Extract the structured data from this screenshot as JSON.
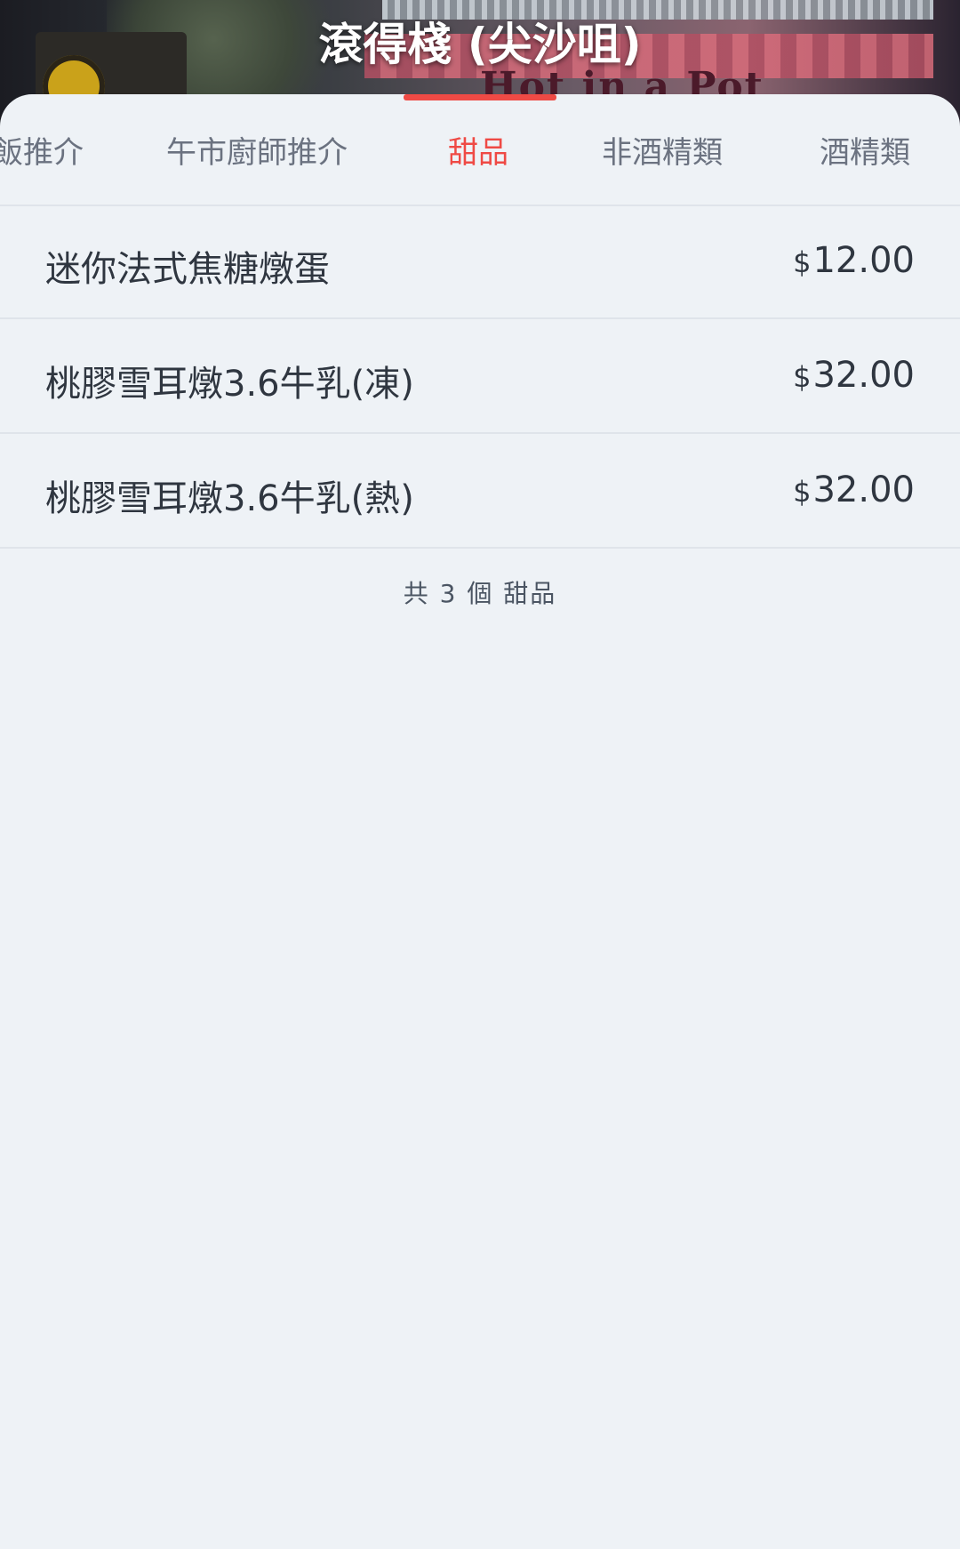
{
  "header": {
    "title": "滾得棧 (尖沙咀)",
    "banner_sign_text": "Hot in a Pot"
  },
  "tabs": [
    {
      "label": "飯推介",
      "active": false
    },
    {
      "label": "午市廚師推介",
      "active": false
    },
    {
      "label": "甜品",
      "active": true
    },
    {
      "label": "非酒精類",
      "active": false
    },
    {
      "label": "酒精類",
      "active": false
    }
  ],
  "items": [
    {
      "name": "迷你法式焦糖燉蛋",
      "currency": "$",
      "price": "12.00"
    },
    {
      "name": "桃膠雪耳燉3.6牛乳(凍)",
      "currency": "$",
      "price": "32.00"
    },
    {
      "name": "桃膠雪耳燉3.6牛乳(熱)",
      "currency": "$",
      "price": "32.00"
    }
  ],
  "summary": "共 3 個 甜品",
  "colors": {
    "accent": "#ef4a45",
    "background": "#eef2f6",
    "text": "#2f3640",
    "muted_text": "#6b7280"
  }
}
